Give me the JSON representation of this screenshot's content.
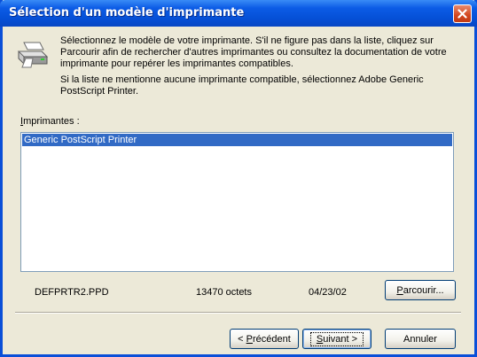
{
  "window": {
    "title": "Sélection d'un modèle d'imprimante"
  },
  "description": {
    "line1": "Sélectionnez le modèle de votre imprimante. S'il ne figure pas dans la liste, cliquez sur Parcourir afin de rechercher d'autres imprimantes ou consultez la documentation de votre imprimante pour repérer les imprimantes compatibles.",
    "line2": "Si la liste ne mentionne aucune imprimante compatible, sélectionnez Adobe Generic PostScript Printer."
  },
  "printers": {
    "label_underlined": "I",
    "label_rest": "mprimantes :",
    "items": [
      {
        "name": "Generic PostScript Printer",
        "selected": true
      }
    ]
  },
  "file_info": {
    "filename": "DEFPRTR2.PPD",
    "size": "13470 octets",
    "date": "04/23/02"
  },
  "buttons": {
    "browse_underlined": "P",
    "browse_rest": "arcourir...",
    "prev_prefix": "< ",
    "prev_underlined": "P",
    "prev_rest": "récédent",
    "next_underlined": "S",
    "next_rest": "uivant >",
    "cancel": "Annuler"
  },
  "colors": {
    "titlebar": "#0550d6",
    "selection": "#316ac5",
    "dialog_bg": "#ece9d8",
    "close_button": "#d2471f"
  }
}
